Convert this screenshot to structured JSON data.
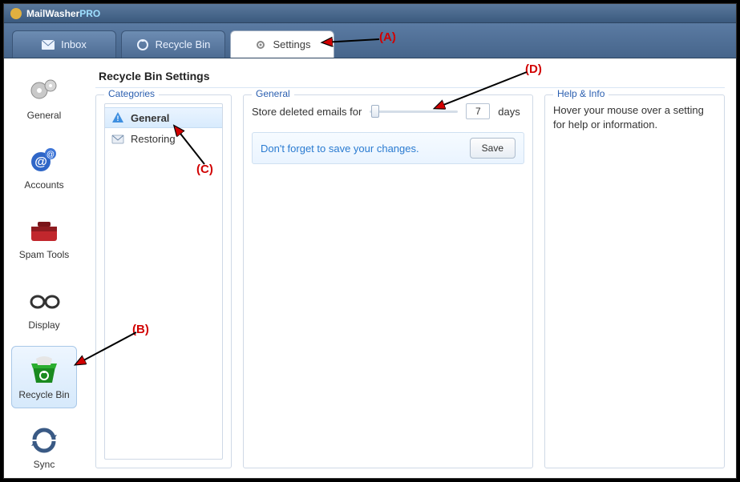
{
  "app": {
    "brand1": "MailWasher",
    "brand2": "PRO"
  },
  "tabs": {
    "inbox": "Inbox",
    "recycle": "Recycle Bin",
    "settings": "Settings"
  },
  "sidebar": {
    "general": "General",
    "accounts": "Accounts",
    "spam": "Spam Tools",
    "display": "Display",
    "recycle": "Recycle Bin",
    "sync": "Sync"
  },
  "page": {
    "title": "Recycle Bin Settings"
  },
  "categories": {
    "legend": "Categories",
    "general": "General",
    "restoring": "Restoring"
  },
  "general": {
    "legend": "General",
    "label": "Store deleted emails for",
    "days_value": "7",
    "days_unit": "days",
    "save_msg": "Don't forget to save your changes.",
    "save_btn": "Save"
  },
  "help": {
    "legend": "Help & Info",
    "text": "Hover your mouse over a setting for help or information."
  },
  "annotations": {
    "a": "(A)",
    "b": "(B)",
    "c": "(C)",
    "d": "(D)"
  }
}
